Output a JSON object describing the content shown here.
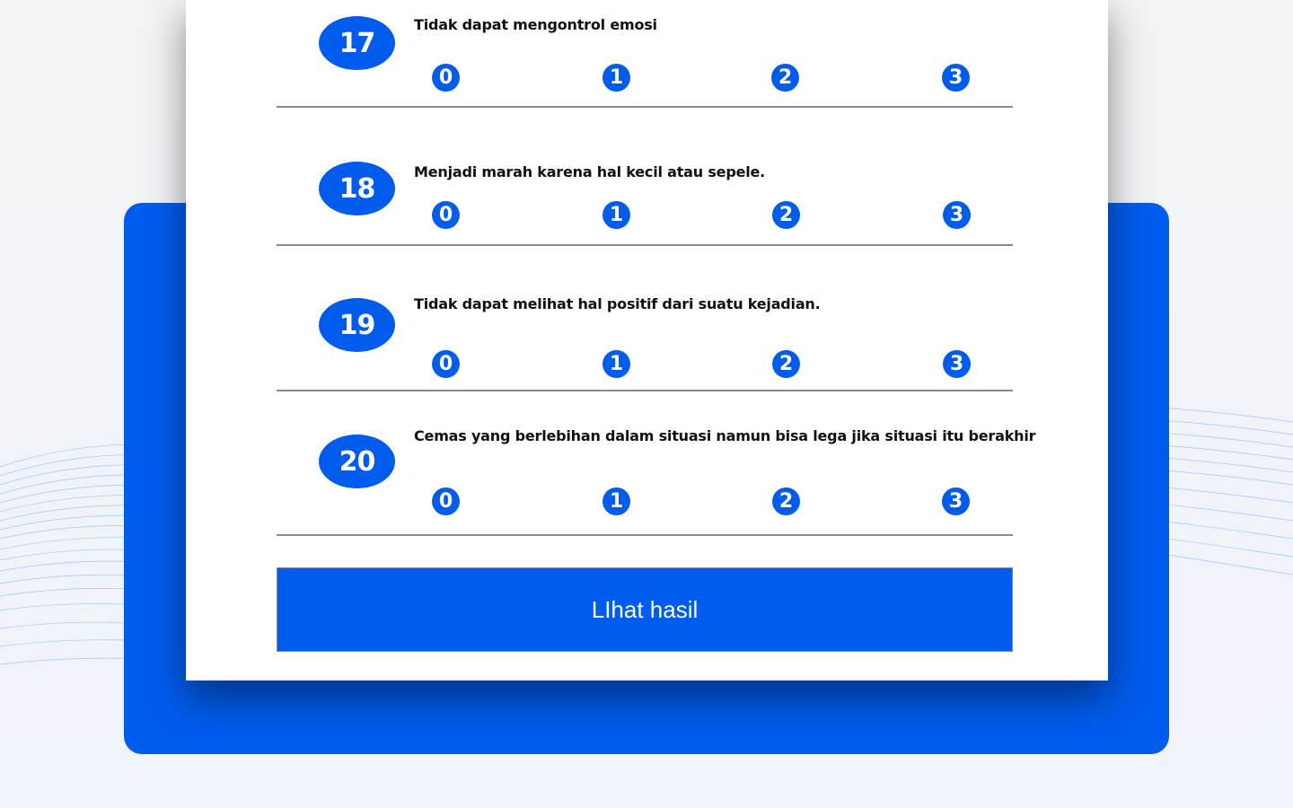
{
  "colors": {
    "accent": "#005cec",
    "panel": "#005cec",
    "card": "#ffffff",
    "divider": "#8a8a8a"
  },
  "questions": [
    {
      "number": "17",
      "text": "Tidak dapat mengontrol emosi",
      "options": [
        "0",
        "1",
        "2",
        "3"
      ]
    },
    {
      "number": "18",
      "text": "Menjadi marah karena hal kecil atau sepele.",
      "options": [
        "0",
        "1",
        "2",
        "3"
      ]
    },
    {
      "number": "19",
      "text": "Tidak dapat melihat hal positif dari suatu kejadian.",
      "options": [
        "0",
        "1",
        "2",
        "3"
      ]
    },
    {
      "number": "20",
      "text": "Cemas yang berlebihan dalam situasi namun bisa lega jika situasi itu berakhir",
      "options": [
        "0",
        "1",
        "2",
        "3"
      ]
    }
  ],
  "submit_label": "LIhat hasil"
}
